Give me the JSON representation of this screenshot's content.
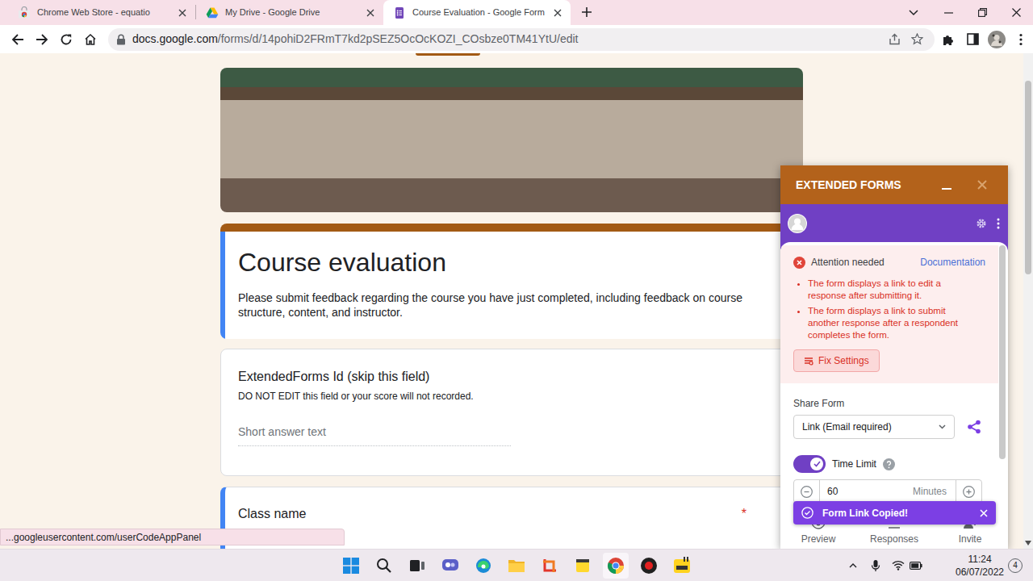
{
  "browser": {
    "tabs": [
      {
        "label": "Chrome Web Store - equatio",
        "selected": false
      },
      {
        "label": "My Drive - Google Drive",
        "selected": false
      },
      {
        "label": "Course Evaluation - Google Form",
        "selected": true
      }
    ],
    "url_host": "docs.google.com",
    "url_path": "/forms/d/14pohiD2FRmT7kd2pSEZ5OcOcKOZI_COsbze0TM41YtU/edit"
  },
  "form": {
    "title": "Course evaluation",
    "description": "Please submit feedback regarding the course you have just completed, including feedback on course structure, content, and instructor.",
    "header_selected": true,
    "required_mark": "*",
    "questions": [
      {
        "title": "ExtendedForms Id (skip this field)",
        "help": "DO NOT EDIT this field or your score will not recorded.",
        "placeholder": "Short answer text",
        "required": false,
        "selected": false
      },
      {
        "title": "Class name",
        "required": true,
        "selected": true
      }
    ]
  },
  "extension": {
    "title": "EXTENDED FORMS",
    "attention": {
      "title": "Attention needed",
      "link": "Documentation",
      "items": [
        "The form displays a link to edit a response after submitting it.",
        "The form displays a link to submit another response after a respondent completes the form."
      ],
      "button": "Fix Settings"
    },
    "share": {
      "label": "Share Form",
      "value": "Link (Email required)"
    },
    "time_limit": {
      "label": "Time Limit",
      "on": true,
      "value": "60",
      "unit": "Minutes"
    },
    "toast": "Form Link Copied!",
    "nav": [
      {
        "label": "Preview"
      },
      {
        "label": "Responses"
      },
      {
        "label": "Invite"
      }
    ]
  },
  "status_bar": "...googleusercontent.com/userCodeAppPanel",
  "taskbar": {
    "time": "11:24",
    "date": "06/07/2022",
    "badge": "4"
  }
}
